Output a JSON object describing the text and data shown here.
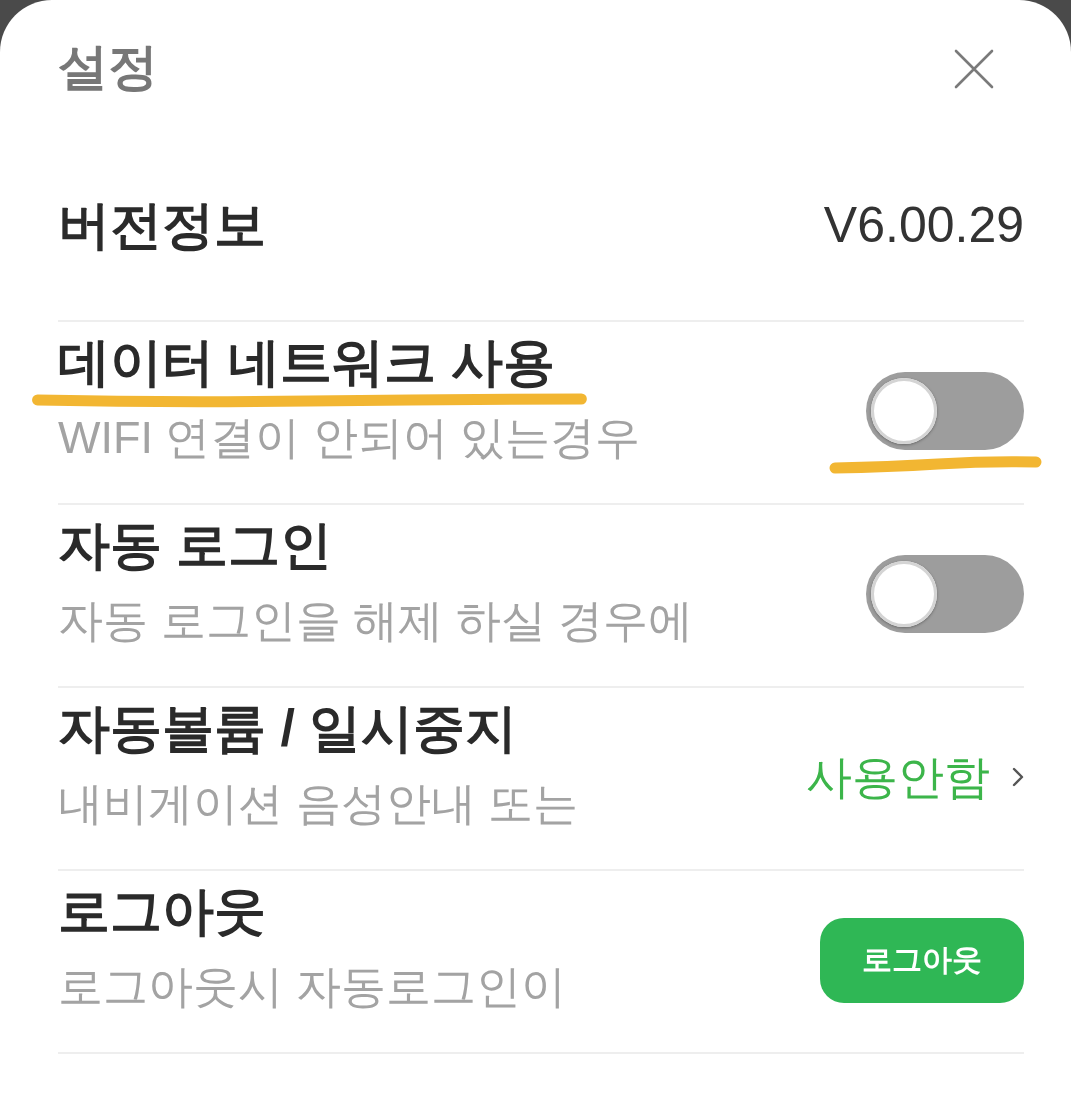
{
  "header": {
    "title": "설정"
  },
  "rows": [
    {
      "kind": "value",
      "title": "버전정보",
      "value": "V6.00.29",
      "highlighted": false
    },
    {
      "kind": "toggle",
      "title": "데이터 네트워크 사용",
      "description": "WIFI 연결이 안되어 있는경우",
      "on": false,
      "highlighted": true
    },
    {
      "kind": "toggle",
      "title": "자동 로그인",
      "description": "자동 로그인을 해제 하실 경우에",
      "on": false,
      "highlighted": false
    },
    {
      "kind": "link",
      "title": "자동볼륨 / 일시중지",
      "description": "내비게이션 음성안내 또는",
      "value": "사용안함",
      "highlighted": false
    },
    {
      "kind": "button",
      "title": "로그아웃",
      "description": "로그아웃시 자동로그인이",
      "button": "로그아웃",
      "highlighted": false
    }
  ]
}
